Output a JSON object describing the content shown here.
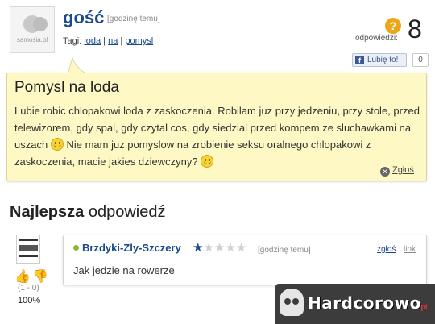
{
  "question": {
    "asker_name": "gość",
    "asker_time": "[godzinę temu]",
    "tags_label": "Tagi:",
    "tags": [
      "loda",
      "na",
      "pomysl"
    ],
    "answers_label": "odpowiedzi:",
    "answers_count": "8",
    "like_label": "Lubię to!",
    "like_count": "0",
    "avatar_caption": "samosia.pl",
    "title": "Pomysl na loda",
    "body_part1": "Lubie robic chlopakowi loda z zaskoczenia. Robilam juz przy jedzeniu, przy stole, przed telewizorem, gdy spal, gdy czytal cos, gdy siedzial przed kompem ze sluchawkami na uszach",
    "body_part2": "Nie mam juz pomyslow na zrobienie seksu oralnego chlopakowi z zaskoczenia, macie jakies dziewczyny?",
    "report_label": "Zgłoś"
  },
  "best_answer": {
    "heading_bold": "Najlepsza",
    "heading_rest": "odpowiedź",
    "author": "Brzdyki-Zly-Szczery",
    "rating": 1,
    "rating_max": 5,
    "time": "[godzinę temu]",
    "report_label": "zgłoś",
    "link_label": "link",
    "body": "Jak jedzie na rowerze",
    "votes": "(1 - 0)",
    "percent": "100%"
  },
  "watermark": {
    "text": "Hardcorowo",
    "tld": ".pl"
  },
  "colors": {
    "link_blue": "#1a4a8a",
    "bubble_bg": "#fdf8c4",
    "accent_orange": "#e8a818"
  }
}
